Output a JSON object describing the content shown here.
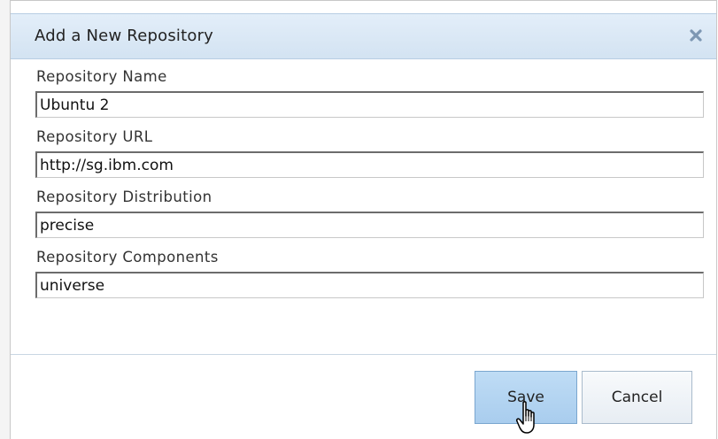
{
  "dialog": {
    "title": "Add a New Repository",
    "close_icon": "close-x-icon"
  },
  "fields": [
    {
      "label": "Repository Name",
      "value": "Ubuntu 2"
    },
    {
      "label": "Repository URL",
      "value": "http://sg.ibm.com"
    },
    {
      "label": "Repository Distribution",
      "value": "precise"
    },
    {
      "label": "Repository Components",
      "value": "universe"
    }
  ],
  "buttons": {
    "save": "Save",
    "cancel": "Cancel"
  },
  "colors": {
    "titlebar": "#d8e7f5",
    "save_button": "#b3d4f1",
    "close_icon": "#7d97b3"
  },
  "cursor": "hand-pointer-icon"
}
